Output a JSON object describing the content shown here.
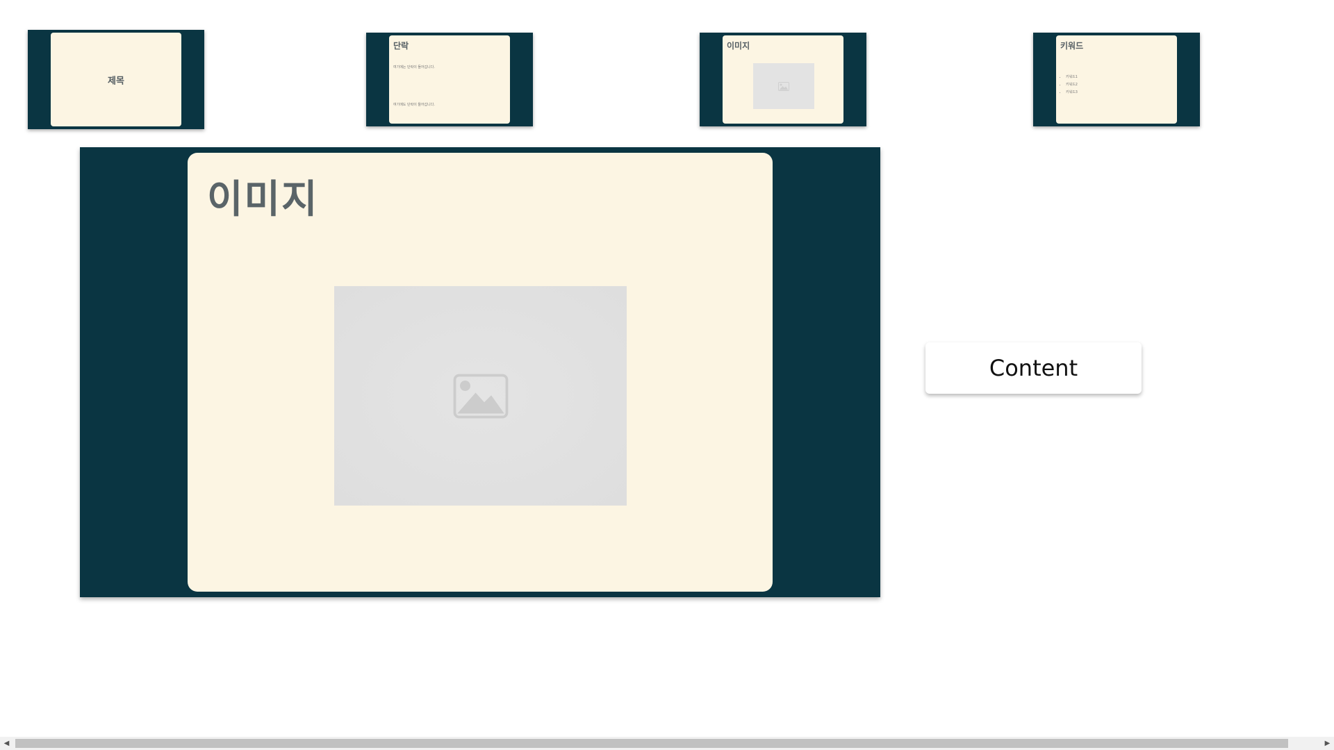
{
  "slides": [
    {
      "title": "제목"
    },
    {
      "title": "단락",
      "paragraphs": [
        "여기에는 단락이 들어갑니다.",
        "여기에도 단락이 들어갑니다."
      ]
    },
    {
      "title": "이미지"
    },
    {
      "title": "키워드",
      "keywords": [
        "키워드1",
        "키워드2",
        "키워드3"
      ]
    }
  ],
  "current_slide": {
    "title": "이미지"
  },
  "content_button": {
    "label": "Content"
  },
  "icons": {
    "image_placeholder": "image-placeholder-icon",
    "scroll_left": "arrow-left-icon",
    "scroll_right": "arrow-right-icon"
  },
  "colors": {
    "slide_bg": "#0a3542",
    "card_bg": "#fcf5e3",
    "title_text": "#5a6468"
  }
}
